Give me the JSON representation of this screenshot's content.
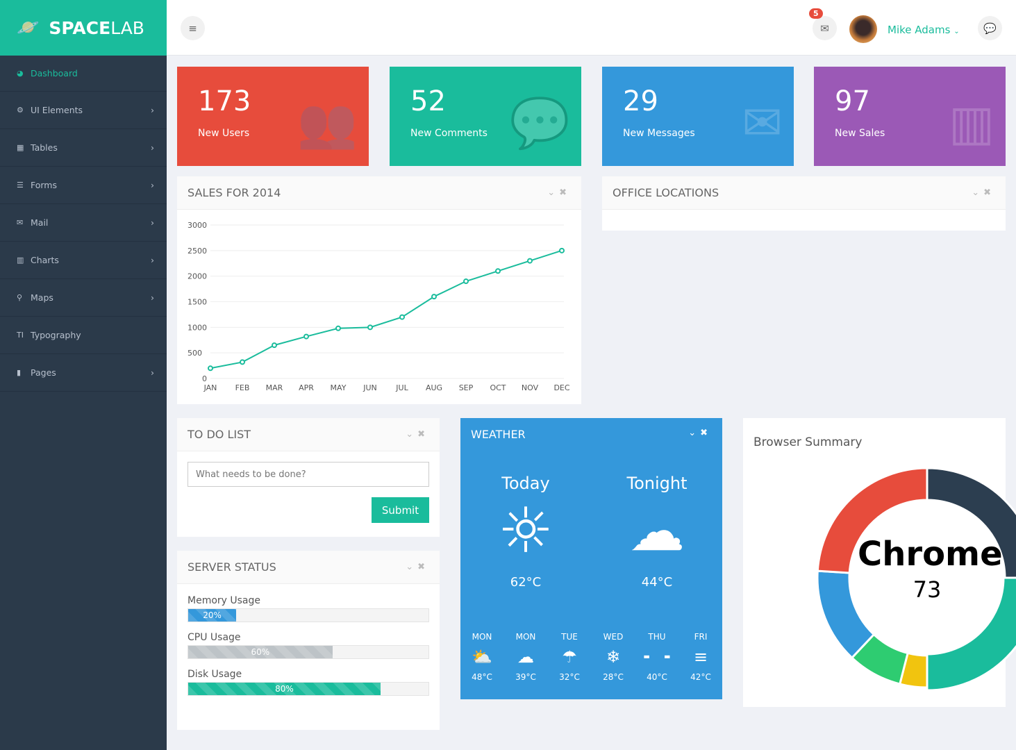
{
  "brand": {
    "bold": "SPACE",
    "light": "LAB"
  },
  "sidebar": {
    "items": [
      {
        "label": "Dashboard",
        "icon": "dashboard-icon",
        "glyph": "◕"
      },
      {
        "label": "UI Elements",
        "icon": "cogs-icon",
        "glyph": "⚙"
      },
      {
        "label": "Tables",
        "icon": "table-icon",
        "glyph": "▦"
      },
      {
        "label": "Forms",
        "icon": "list-icon",
        "glyph": "☰"
      },
      {
        "label": "Mail",
        "icon": "envelope-icon",
        "glyph": "✉"
      },
      {
        "label": "Charts",
        "icon": "bar-chart-icon",
        "glyph": "▥"
      },
      {
        "label": "Maps",
        "icon": "map-marker-icon",
        "glyph": "⚲"
      },
      {
        "label": "Typography",
        "icon": "text-icon",
        "glyph": "TI"
      },
      {
        "label": "Pages",
        "icon": "file-icon",
        "glyph": "▮"
      }
    ]
  },
  "topbar": {
    "mail_badge": "5",
    "user": "Mike Adams"
  },
  "stats": [
    {
      "value": "173",
      "label": "New Users",
      "color": "#e74c3c",
      "glyph": "👥"
    },
    {
      "value": "52",
      "label": "New Comments",
      "color": "#1abc9c",
      "glyph": "💬"
    },
    {
      "value": "29",
      "label": "New Messages",
      "color": "#3498db",
      "glyph": "✉"
    },
    {
      "value": "97",
      "label": "New Sales",
      "color": "#9b59b6",
      "glyph": "▥"
    }
  ],
  "sales": {
    "title": "SALES FOR 2014"
  },
  "office": {
    "title": "OFFICE LOCATIONS"
  },
  "todo": {
    "title": "TO DO LIST",
    "placeholder": "What needs to be done?",
    "submit": "Submit"
  },
  "server": {
    "title": "SERVER STATUS",
    "items": [
      {
        "label": "Memory Usage",
        "percent": 20,
        "text": "20%",
        "color": "#3498db"
      },
      {
        "label": "CPU Usage",
        "percent": 60,
        "text": "60%",
        "color": "#bdc3c7"
      },
      {
        "label": "Disk Usage",
        "percent": 80,
        "text": "80%",
        "color": "#1abc9c"
      }
    ]
  },
  "weather": {
    "title": "WEATHER",
    "today": {
      "label": "Today",
      "temp": "62°C"
    },
    "tonight": {
      "label": "Tonight",
      "temp": "44°C"
    },
    "days": [
      {
        "day": "MON",
        "temp": "48°C",
        "glyph": "⛅"
      },
      {
        "day": "MON",
        "temp": "39°C",
        "glyph": "☁"
      },
      {
        "day": "TUE",
        "temp": "32°C",
        "glyph": "☂"
      },
      {
        "day": "WED",
        "temp": "28°C",
        "glyph": "❄"
      },
      {
        "day": "THU",
        "temp": "40°C",
        "glyph": "╸ ╺"
      },
      {
        "day": "FRI",
        "temp": "42°C",
        "glyph": "≡"
      }
    ]
  },
  "browser": {
    "title": "Browser Summary",
    "center_label": "Chrome",
    "center_value": "73"
  },
  "chart_data": [
    {
      "type": "line",
      "title": "SALES FOR 2014",
      "categories": [
        "JAN",
        "FEB",
        "MAR",
        "APR",
        "MAY",
        "JUN",
        "JUL",
        "AUG",
        "SEP",
        "OCT",
        "NOV",
        "DEC"
      ],
      "values": [
        200,
        320,
        650,
        820,
        980,
        1000,
        1200,
        1600,
        1900,
        2100,
        2300,
        2500
      ],
      "ylim": [
        0,
        3000
      ],
      "yticks": [
        0,
        500,
        1000,
        1500,
        2000,
        2500,
        3000
      ],
      "grid": true,
      "color": "#1abc9c"
    },
    {
      "type": "pie",
      "title": "Browser Summary",
      "values": [
        25,
        25,
        4,
        8,
        14,
        24
      ],
      "colors": [
        "#2c3e50",
        "#1abc9c",
        "#f1c40f",
        "#2ecc71",
        "#3498db",
        "#e74c3c"
      ],
      "highlighted": 1
    }
  ]
}
